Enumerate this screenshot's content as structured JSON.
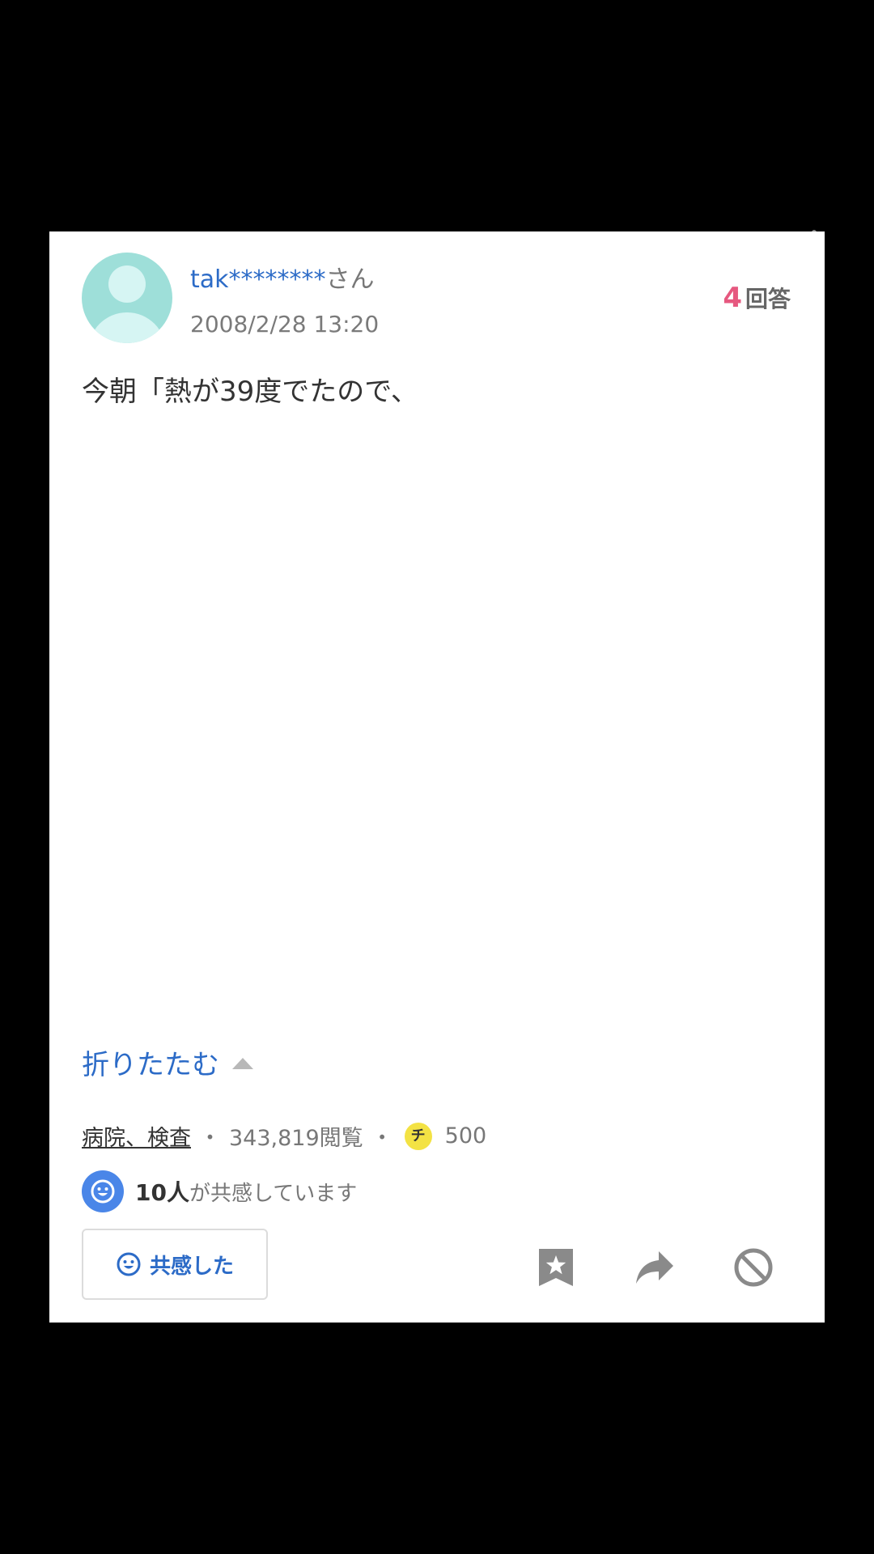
{
  "question": {
    "user_name": "tak********",
    "user_suffix": "さん",
    "date": "2008/2/28 13:20",
    "answer_count": "4",
    "answer_label": "回答",
    "text": "今朝「熱が39度でたので、"
  },
  "collapse": {
    "label": "折りたたむ"
  },
  "meta": {
    "category": "病院、検査",
    "separator": "・",
    "views": "343,819閲覧",
    "coin_glyph": "チ",
    "coins": "500"
  },
  "empathy": {
    "count": "10人",
    "text": "が共感しています"
  },
  "actions": {
    "empathize_label": "共感した",
    "icons": [
      "bookmark-star-icon",
      "share-icon",
      "block-icon"
    ]
  },
  "colors": {
    "link_blue": "#2c6bc7",
    "answer_pink": "#e6587f",
    "avatar_teal": "#9edfd9",
    "coin_yellow": "#f3e244",
    "empathy_blue": "#4a86e8"
  }
}
